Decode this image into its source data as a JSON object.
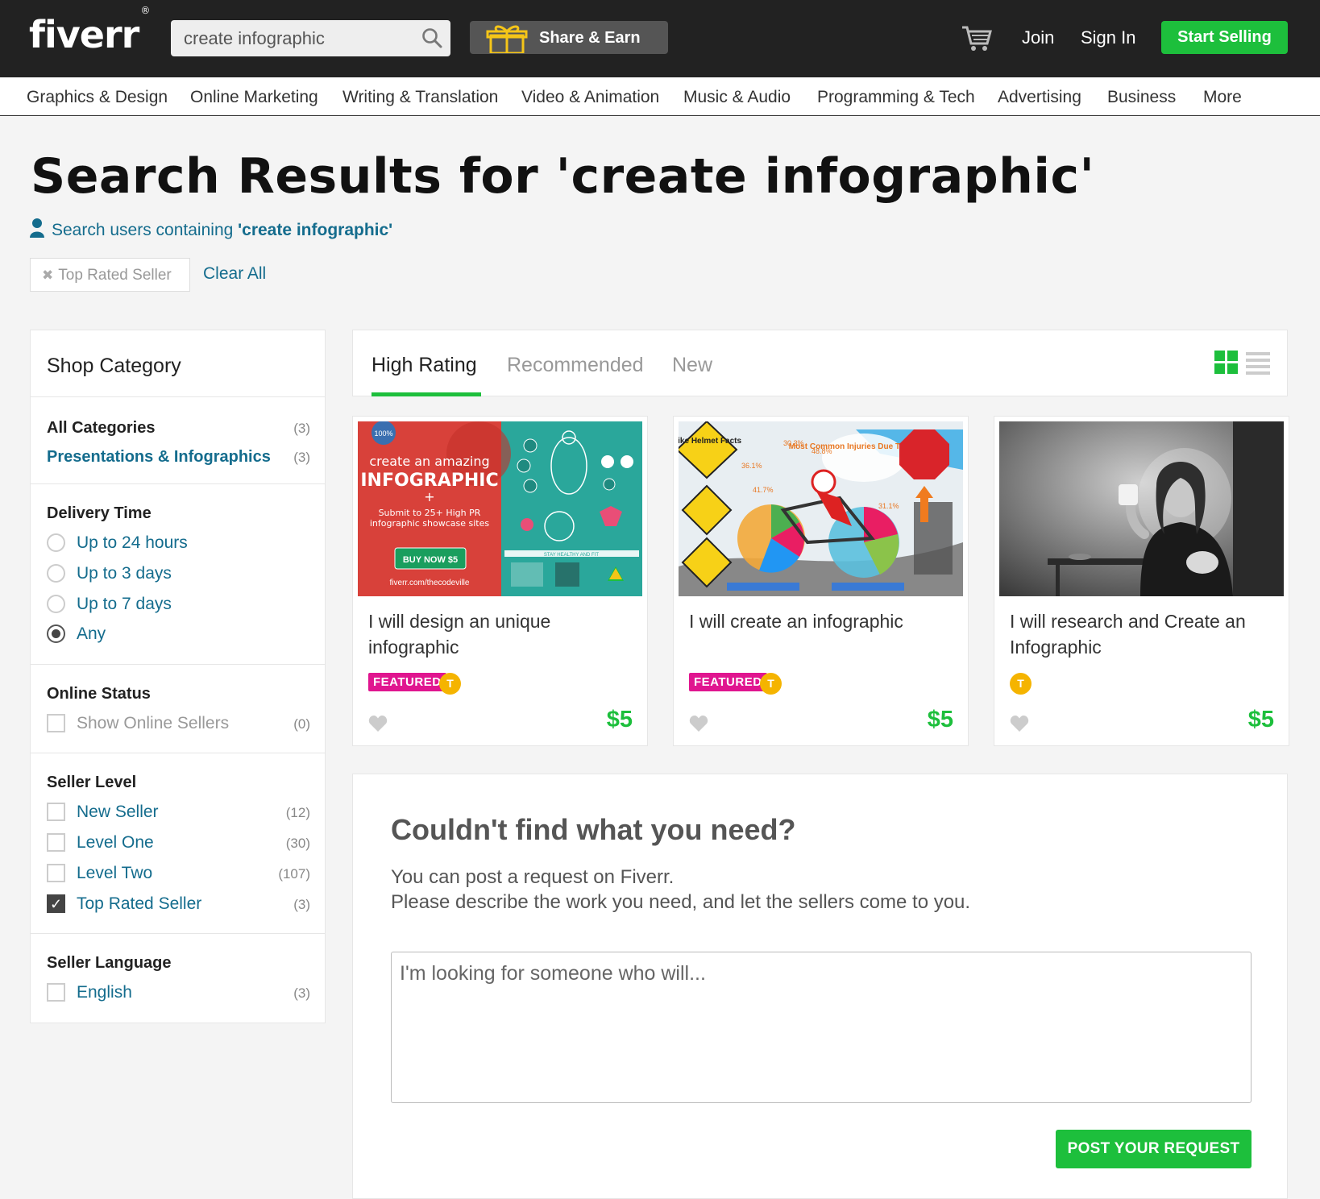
{
  "header": {
    "logo": "fiverr",
    "logo_mark": "®",
    "search_value": "create infographic",
    "share_label": "Share & Earn",
    "join_label": "Join",
    "signin_label": "Sign In",
    "start_selling_label": "Start Selling"
  },
  "categories": [
    "Graphics & Design",
    "Online Marketing",
    "Writing & Translation",
    "Video & Animation",
    "Music & Audio",
    "Programming & Tech",
    "Advertising",
    "Business",
    "More"
  ],
  "page": {
    "title": "Search Results for 'create infographic'",
    "user_search_prefix": "Search users containing ",
    "user_search_term": "'create infographic'",
    "active_filter": "Top Rated Seller",
    "clear_all": "Clear All"
  },
  "sidebar": {
    "title": "Shop Category",
    "all_categories": {
      "label": "All Categories",
      "count": "(3)"
    },
    "sub_category": {
      "label": "Presentations & Infographics",
      "count": "(3)"
    },
    "delivery": {
      "heading": "Delivery Time",
      "options": [
        "Up to 24 hours",
        "Up to 3 days",
        "Up to 7 days",
        "Any"
      ],
      "selected": "Any"
    },
    "online": {
      "heading": "Online Status",
      "label": "Show Online Sellers",
      "count": "(0)"
    },
    "seller_level": {
      "heading": "Seller Level",
      "options": [
        {
          "label": "New Seller",
          "count": "(12)",
          "checked": false
        },
        {
          "label": "Level One",
          "count": "(30)",
          "checked": false
        },
        {
          "label": "Level Two",
          "count": "(107)",
          "checked": false
        },
        {
          "label": "Top Rated Seller",
          "count": "(3)",
          "checked": true
        }
      ]
    },
    "language": {
      "heading": "Seller Language",
      "label": "English",
      "count": "(3)"
    }
  },
  "tabs": [
    "High Rating",
    "Recommended",
    "New"
  ],
  "active_tab": "High Rating",
  "gigs": [
    {
      "title": "I will design an unique infographic",
      "featured": "FEATURED",
      "badge": "T",
      "price": "$5",
      "thumb_text": {
        "line1": "create an amazing",
        "line2": "INFOGRAPHIC",
        "line3": "+",
        "line4": "Submit to 25+ High PR",
        "line5": "infographic showcase sites",
        "button": "BUY NOW $5",
        "url": "fiverr.com/thecodeville",
        "seal": "100%",
        "footer": "STAY HEALTHY AND FIT"
      }
    },
    {
      "title": "I will create an infographic",
      "featured": "FEATURED",
      "badge": "T",
      "price": "$5",
      "thumb_text": {
        "sign1": "Bike Helmet Facts",
        "sign2": "Most Common Injuries Due To Overuse",
        "stat1": "30.3%",
        "stat2": "48.8%",
        "stat3": "36.1%",
        "stat4": "41.7%",
        "stat5": "31.1%"
      }
    },
    {
      "title": "I will research and Create an Infographic",
      "featured": "",
      "badge": "T",
      "price": "$5"
    }
  ],
  "request": {
    "heading": "Couldn't find what you need?",
    "line1": "You can post a request on Fiverr.",
    "line2": "Please describe the work you need, and let the sellers come to you.",
    "placeholder": "I'm looking for someone who will...",
    "button": "POST YOUR REQUEST"
  },
  "colors": {
    "brand_green": "#1dbf3c",
    "link_blue": "#146c8d",
    "featured_pink": "#e0158f",
    "badge_gold": "#f5b400",
    "header_dark": "#222222"
  }
}
